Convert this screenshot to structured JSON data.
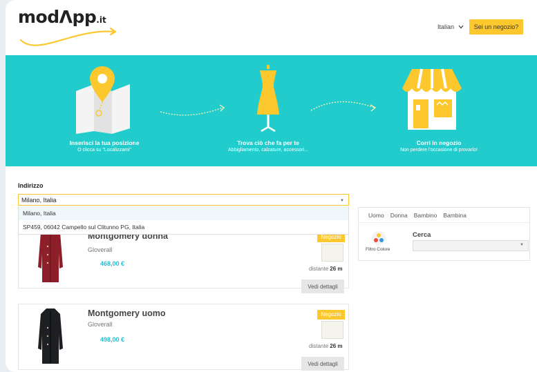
{
  "header": {
    "logo_text": "modΛpp",
    "logo_suffix": ".it",
    "language": "Italian",
    "shop_button": "Sei un negozio?"
  },
  "banner": {
    "steps": [
      {
        "title": "Inserisci la tua posizione",
        "subtitle": "O clicca su \"Localizzami\"",
        "icon": "map-pin-icon"
      },
      {
        "title": "Trova ciò che fa per te",
        "subtitle": "Abbigliamento, calzature, accessori...",
        "icon": "dress-form-icon"
      },
      {
        "title": "Corri in negozio",
        "subtitle": "Non perdere l'occasione di provarlo!",
        "icon": "storefront-icon"
      }
    ]
  },
  "address": {
    "label": "Indirizzo",
    "value": "Milano, Italia",
    "suggestions": [
      "Milano, Italia",
      "SP459, 06042 Campello sul Clitunno PG, Italia"
    ]
  },
  "products": [
    {
      "name": "Montgomery donna",
      "brand": "Gloverall",
      "price": "468,00 €",
      "badge": "Negozio",
      "distance_prefix": "distante",
      "distance": "26 m",
      "details": "Vedi dettagli",
      "coat_color": "#8c1f2a"
    },
    {
      "name": "Montgomery uomo",
      "brand": "Gloverall",
      "price": "498,00 €",
      "badge": "Negozio",
      "distance_prefix": "distante",
      "distance": "26 m",
      "details": "Vedi dettagli",
      "coat_color": "#1e1f22"
    }
  ],
  "filter": {
    "tabs": [
      "Uomo",
      "Donna",
      "Bambino",
      "Bambina"
    ],
    "color_filter_label": "Filtro Colore",
    "search_label": "Cerca"
  },
  "colors": {
    "brand_yellow": "#fcc82e",
    "banner_teal": "#23cccc",
    "price_blue": "#2bbcd0"
  }
}
